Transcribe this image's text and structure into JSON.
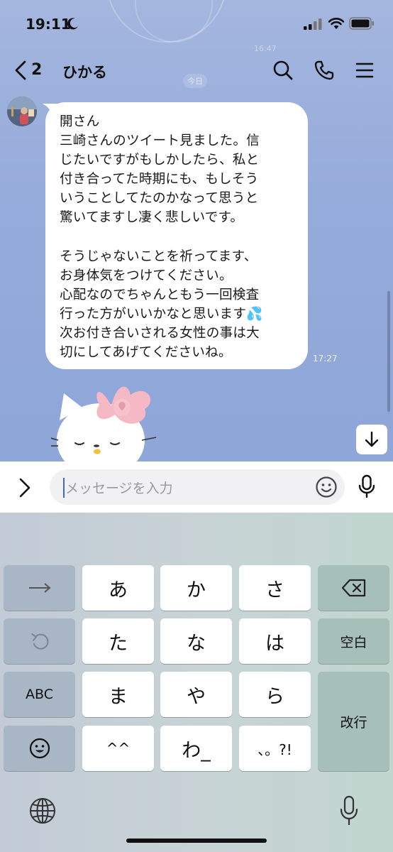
{
  "status_bar": {
    "time": "19:11"
  },
  "header": {
    "back_count": "2",
    "chat_name": "ひかる"
  },
  "background": {
    "ghost_time": "16:47",
    "date_chip": "今日"
  },
  "message": {
    "text": "開さん\n三崎さんのツイート見ました。信\nじたいですがもしかしたら、私と\n付き合ってた時期にも、もしそう\nいうことしてたのかなって思うと\n驚いてますし凄く悲しいです。\n\nそうじゃないことを祈ってます、\nお身体気をつけてください。\n心配なのでちゃんともう一回検査\n行った方がいいかなと思います💦\n次お付き合いされる女性の事は大\n切にしてあげてくださいね。",
    "time": "17:27"
  },
  "input": {
    "placeholder": "メッセージを入力"
  },
  "keyboard": {
    "rows": [
      [
        "→",
        "あ",
        "か",
        "さ",
        "⌫"
      ],
      [
        "↺",
        "た",
        "な",
        "は",
        "空白"
      ],
      [
        "ABC",
        "ま",
        "や",
        "ら",
        "改行"
      ],
      [
        "☺",
        "^^",
        "わ_",
        "、。?!"
      ]
    ]
  },
  "colors": {
    "chat_bg": "#95abdb",
    "accent": "#3e69d6"
  }
}
